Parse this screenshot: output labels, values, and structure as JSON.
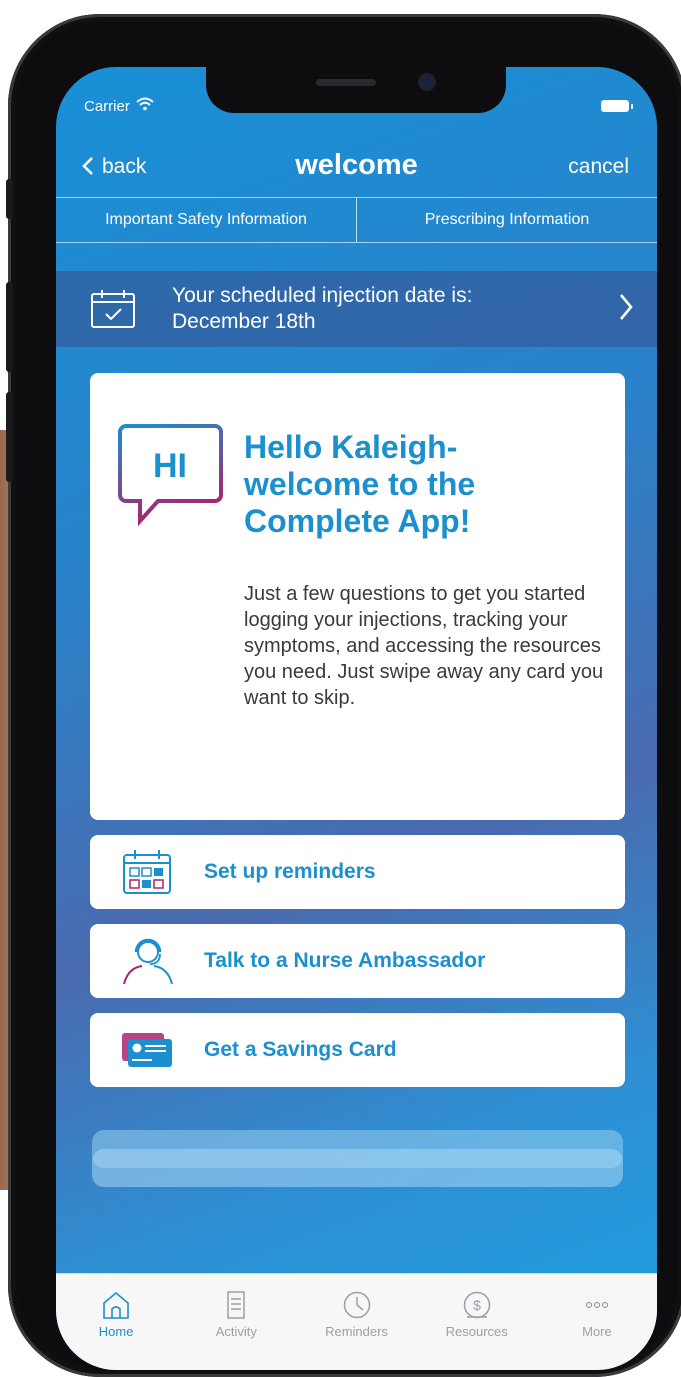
{
  "status": {
    "carrier": "Carrier"
  },
  "nav": {
    "back": "back",
    "title": "welcome",
    "cancel": "cancel"
  },
  "info": {
    "safety": "Important Safety Information",
    "prescribing": "Prescribing Information"
  },
  "schedule": {
    "line1": "Your scheduled injection date is:",
    "line2": "December 18th"
  },
  "welcome": {
    "badge": "HI",
    "title_lines": [
      "Hello Kaleigh-",
      "welcome to the",
      "Complete App!"
    ],
    "body": "Just a few questions to get you started logging your injections, tracking your symptoms, and accessing the resources you need. Just swipe away any card you want to skip."
  },
  "actions": [
    {
      "label": "Set up reminders",
      "icon": "calendar-icon"
    },
    {
      "label": "Talk to a Nurse Ambassador",
      "icon": "nurse-headset-icon"
    },
    {
      "label": "Get a Savings Card",
      "icon": "savings-card-icon"
    }
  ],
  "tabs": [
    {
      "label": "Home",
      "icon": "home-icon",
      "active": true
    },
    {
      "label": "Activity",
      "icon": "activity-icon",
      "active": false
    },
    {
      "label": "Reminders",
      "icon": "clock-icon",
      "active": false
    },
    {
      "label": "Resources",
      "icon": "dollar-icon",
      "active": false
    },
    {
      "label": "More",
      "icon": "more-icon",
      "active": false
    }
  ],
  "colors": {
    "accent": "#1c8fce",
    "inactive": "#9aa0a6",
    "gradient_start": "#1890d6",
    "gradient_mid": "#4a6aae",
    "hi_gradient_end": "#a8246e"
  }
}
